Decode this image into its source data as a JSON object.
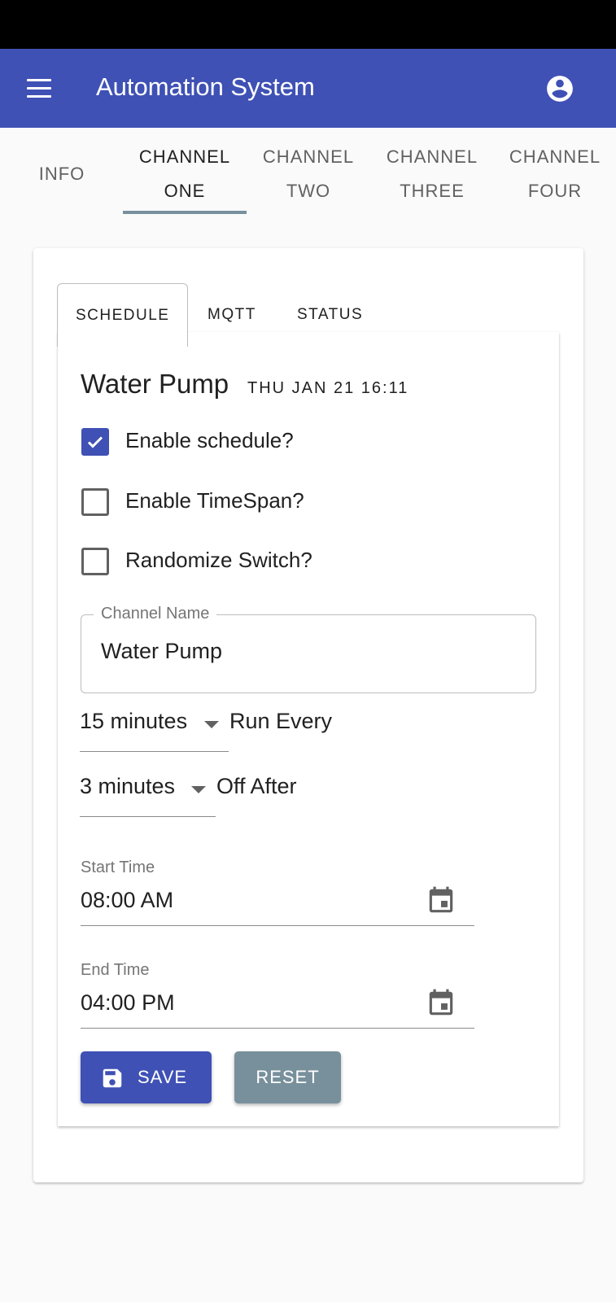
{
  "app": {
    "title": "Automation System",
    "colors": {
      "primary": "#3f51b5",
      "secondary": "#78909c"
    }
  },
  "tabs": [
    {
      "label": "INFO"
    },
    {
      "label_line1": "CHANNEL",
      "label_line2": "ONE",
      "active": true
    },
    {
      "label_line1": "CHANNEL",
      "label_line2": "TWO"
    },
    {
      "label_line1": "CHANNEL",
      "label_line2": "THREE"
    },
    {
      "label_line1": "CHANNEL",
      "label_line2": "FOUR"
    }
  ],
  "subtabs": [
    {
      "label": "SCHEDULE",
      "active": true
    },
    {
      "label": "MQTT"
    },
    {
      "label": "STATUS"
    }
  ],
  "schedule": {
    "title": "Water Pump",
    "date": "THU JAN 21 16:11",
    "checkboxes": [
      {
        "label": "Enable schedule?",
        "checked": true
      },
      {
        "label": "Enable TimeSpan?",
        "checked": false
      },
      {
        "label": "Randomize Switch?",
        "checked": false
      }
    ],
    "channel_name": {
      "label": "Channel Name",
      "value": "Water Pump"
    },
    "run_every": {
      "value": "15 minutes",
      "label": "Run Every"
    },
    "off_after": {
      "value": "3 minutes",
      "label": "Off After"
    },
    "start_time": {
      "label": "Start Time",
      "value": "08:00 AM"
    },
    "end_time": {
      "label": "End Time",
      "value": "04:00 PM"
    },
    "buttons": {
      "save": "SAVE",
      "reset": "RESET"
    }
  },
  "icons": {
    "menu": "menu-icon",
    "account": "account-circle-icon",
    "calendar": "calendar-icon",
    "save": "save-icon",
    "check": "check-icon"
  }
}
